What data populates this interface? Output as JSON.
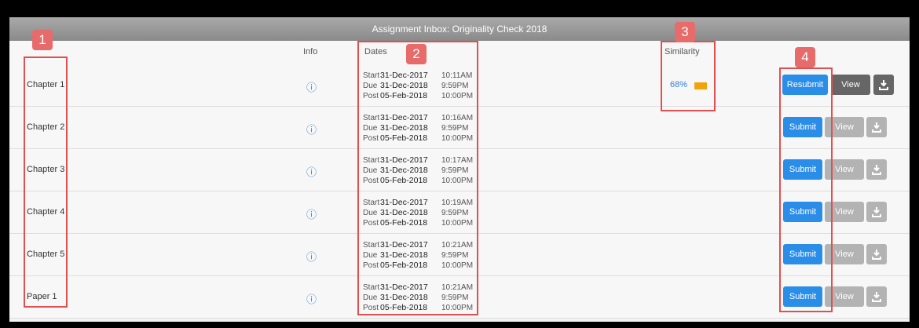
{
  "title": "Assignment Inbox: Originality Check 2018",
  "headers": {
    "info": "Info",
    "dates": "Dates",
    "similarity": "Similarity"
  },
  "annotations": [
    "1",
    "2",
    "3",
    "4"
  ],
  "date_labels": {
    "start": "Start",
    "due": "Due",
    "post": "Post"
  },
  "rows": [
    {
      "name": "Chapter 1",
      "start_date": "31-Dec-2017",
      "start_time": "10:11AM",
      "due_date": "31-Dec-2018",
      "due_time": "9:59PM",
      "post_date": "05-Feb-2018",
      "post_time": "10:00PM",
      "similarity": "68%",
      "action": "Resubmit",
      "view": "View"
    },
    {
      "name": "Chapter 2",
      "start_date": "31-Dec-2017",
      "start_time": "10:16AM",
      "due_date": "31-Dec-2018",
      "due_time": "9:59PM",
      "post_date": "05-Feb-2018",
      "post_time": "10:00PM",
      "similarity": "",
      "action": "Submit",
      "view": "View"
    },
    {
      "name": "Chapter 3",
      "start_date": "31-Dec-2017",
      "start_time": "10:17AM",
      "due_date": "31-Dec-2018",
      "due_time": "9:59PM",
      "post_date": "05-Feb-2018",
      "post_time": "10:00PM",
      "similarity": "",
      "action": "Submit",
      "view": "View"
    },
    {
      "name": "Chapter 4",
      "start_date": "31-Dec-2017",
      "start_time": "10:19AM",
      "due_date": "31-Dec-2018",
      "due_time": "9:59PM",
      "post_date": "05-Feb-2018",
      "post_time": "10:00PM",
      "similarity": "",
      "action": "Submit",
      "view": "View"
    },
    {
      "name": "Chapter 5",
      "start_date": "31-Dec-2017",
      "start_time": "10:21AM",
      "due_date": "31-Dec-2018",
      "due_time": "9:59PM",
      "post_date": "05-Feb-2018",
      "post_time": "10:00PM",
      "similarity": "",
      "action": "Submit",
      "view": "View"
    },
    {
      "name": "Paper 1",
      "start_date": "31-Dec-2017",
      "start_time": "10:21AM",
      "due_date": "31-Dec-2018",
      "due_time": "9:59PM",
      "post_date": "05-Feb-2018",
      "post_time": "10:00PM",
      "similarity": "",
      "action": "Submit",
      "view": "View"
    }
  ],
  "icons": {
    "info": "info-circle-icon",
    "download": "download-icon"
  },
  "colors": {
    "primary": "#2a8ee8",
    "similarity_bar": "#f0a30a",
    "annotation": "#e05050"
  }
}
